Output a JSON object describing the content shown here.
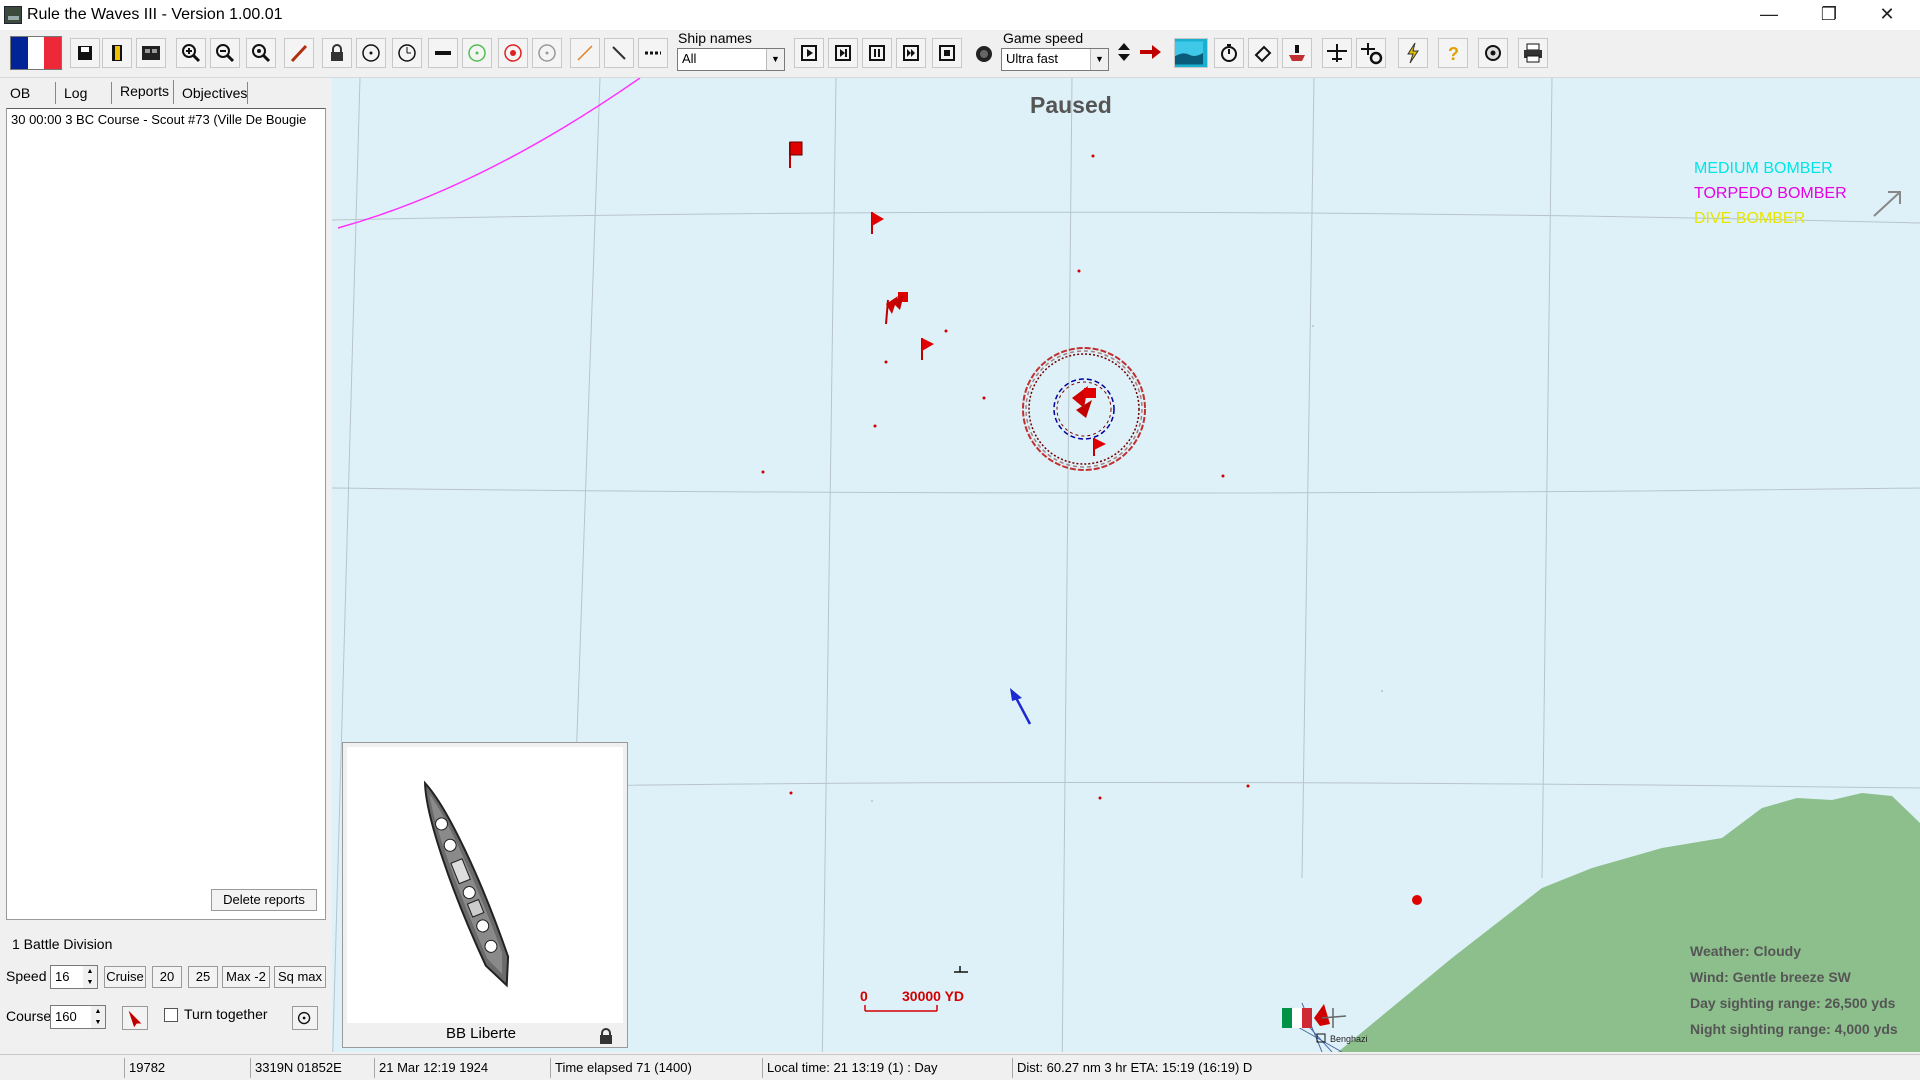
{
  "window": {
    "title": "Rule the Waves III - Version 1.00.01",
    "controls": [
      "—",
      "❐",
      "✕"
    ]
  },
  "toolbar": {
    "flag_colors": [
      "#002395",
      "#ffffff",
      "#ed2939"
    ],
    "ship_names_label": "Ship names",
    "ship_names_value": "All",
    "game_speed_label": "Game speed",
    "game_speed_value": "Ultra fast",
    "buttons": [
      "save-icon",
      "bookmark-icon",
      "film-icon",
      "zoom-in-icon",
      "zoom-out-icon",
      "zoom-reset-icon",
      "brush-icon",
      "lock-icon",
      "circle-icon",
      "clock-circle-icon",
      "line-icon",
      "green-circle-icon",
      "red-circle-icon",
      "grey-circle-icon",
      "orange-line-icon",
      "diagonal-line-icon",
      "dotted-line-icon",
      "play-icon",
      "step-icon",
      "pause-icon",
      "fast-forward-icon",
      "stop-icon",
      "record-icon",
      "red-arrow-icon",
      "map-icon",
      "timer-icon",
      "eraser-icon",
      "ship-icon",
      "aircraft-icon",
      "gear-icon",
      "lightning-icon",
      "help-icon",
      "settings-icon",
      "print-icon"
    ]
  },
  "left_panel": {
    "tabs": [
      "OB",
      "Log",
      "Reports",
      "Objectives"
    ],
    "active_tab": "Reports",
    "reports": [
      "30 00:00  3 BC Course  - Scout #73 (Ville De Bougie"
    ],
    "delete_reports": "Delete reports",
    "division": "1 Battle Division",
    "speed_label": "Speed",
    "speed_value": "16",
    "cruise": "Cruise",
    "speed_20": "20",
    "speed_25": "25",
    "max_minus_2": "Max -2",
    "sq_max": "Sq max",
    "course_label": "Course",
    "course_value": "160",
    "turn_together": "Turn together"
  },
  "map": {
    "paused": "Paused",
    "legend": [
      {
        "label": "MEDIUM BOMBER",
        "color": "#00e5e5"
      },
      {
        "label": "TORPEDO BOMBER",
        "color": "#e600e6"
      },
      {
        "label": "DIVE BOMBER",
        "color": "#e6e600"
      }
    ],
    "weather": [
      "Weather: Cloudy",
      "Wind: Gentle breeze  SW",
      "Day sighting range: 26,500 yds",
      "Night sighting range: 4,000 yds"
    ],
    "scale_zero": "0",
    "scale_label": "30000 YD",
    "port_label": "Benghazi",
    "land_color": "#8cbf8c",
    "sea_color": "#dff1f8"
  },
  "preview": {
    "ship_name": "BB Liberte"
  },
  "statusbar": {
    "id": "19782",
    "position": "3319N 01852E",
    "date": "21 Mar 12:19 1924",
    "elapsed": "Time elapsed 71 (1400)",
    "local_time": "Local time: 21 13:19 (1) : Day",
    "dist": "Dist: 60.27 nm 3 hr ETA: 15:19 (16:19) D"
  }
}
